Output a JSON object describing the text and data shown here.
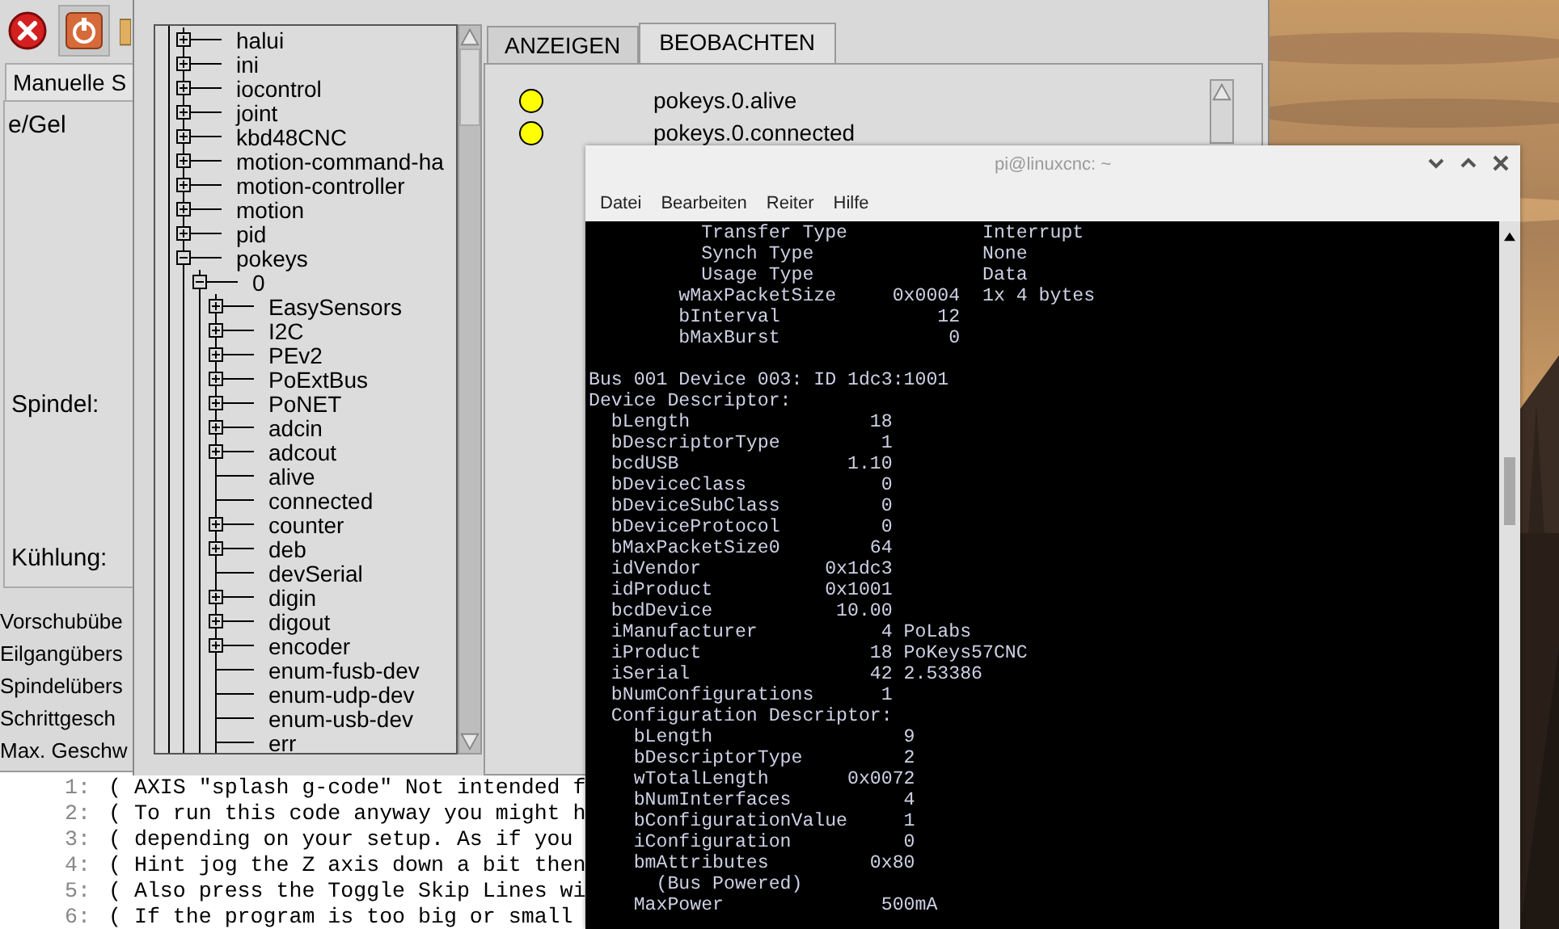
{
  "axis": {
    "tab_label": "Manuelle S",
    "panel_labels": [
      "e/Gel",
      "Spindel:",
      "Kühlung:"
    ],
    "override_labels": [
      "Vorschubübe",
      "Eilgangübers",
      "Spindelübers",
      "Schrittgesch",
      "Max. Geschw"
    ],
    "program": [
      {
        "number": "1:",
        "text": "( AXIS \"splash g-code\" Not intended f"
      },
      {
        "number": "2:",
        "text": "( To run this code anyway you might h"
      },
      {
        "number": "3:",
        "text": "( depending on your setup. As if you"
      },
      {
        "number": "4:",
        "text": "( Hint jog the Z axis down a bit then"
      },
      {
        "number": "5:",
        "text": "( Also press the Toggle Skip Lines wi"
      },
      {
        "number": "6:",
        "text": "( If the program is too big or small"
      }
    ]
  },
  "hal": {
    "tree": [
      {
        "label": "halui",
        "kind": "branch",
        "expanded": false
      },
      {
        "label": "ini",
        "kind": "branch",
        "expanded": false
      },
      {
        "label": "iocontrol",
        "kind": "branch",
        "expanded": false
      },
      {
        "label": "joint",
        "kind": "branch",
        "expanded": false
      },
      {
        "label": "kbd48CNC",
        "kind": "branch",
        "expanded": false
      },
      {
        "label": "motion-command-ha",
        "kind": "branch",
        "expanded": false
      },
      {
        "label": "motion-controller",
        "kind": "branch",
        "expanded": false
      },
      {
        "label": "motion",
        "kind": "branch",
        "expanded": false
      },
      {
        "label": "pid",
        "kind": "branch",
        "expanded": false
      },
      {
        "label": "pokeys",
        "kind": "branch",
        "expanded": true,
        "children": [
          {
            "label": "0",
            "kind": "branch",
            "expanded": true,
            "children": [
              {
                "label": "EasySensors",
                "kind": "branch",
                "expanded": false
              },
              {
                "label": "I2C",
                "kind": "branch",
                "expanded": false
              },
              {
                "label": "PEv2",
                "kind": "branch",
                "expanded": false
              },
              {
                "label": "PoExtBus",
                "kind": "branch",
                "expanded": false
              },
              {
                "label": "PoNET",
                "kind": "branch",
                "expanded": false
              },
              {
                "label": "adcin",
                "kind": "branch",
                "expanded": false
              },
              {
                "label": "adcout",
                "kind": "branch",
                "expanded": false
              },
              {
                "label": "alive",
                "kind": "leaf"
              },
              {
                "label": "connected",
                "kind": "leaf"
              },
              {
                "label": "counter",
                "kind": "branch",
                "expanded": false
              },
              {
                "label": "deb",
                "kind": "branch",
                "expanded": false
              },
              {
                "label": "devSerial",
                "kind": "leaf"
              },
              {
                "label": "digin",
                "kind": "branch",
                "expanded": false
              },
              {
                "label": "digout",
                "kind": "branch",
                "expanded": false
              },
              {
                "label": "encoder",
                "kind": "branch",
                "expanded": false
              },
              {
                "label": "enum-fusb-dev",
                "kind": "leaf"
              },
              {
                "label": "enum-udp-dev",
                "kind": "leaf"
              },
              {
                "label": "enum-usb-dev",
                "kind": "leaf"
              },
              {
                "label": "err",
                "kind": "leaf"
              }
            ]
          }
        ]
      }
    ],
    "tabs": [
      {
        "label": "ANZEIGEN",
        "selected": false
      },
      {
        "label": "BEOBACHTEN",
        "selected": true
      }
    ],
    "watch": [
      {
        "name": "pokeys.0.alive",
        "on": true
      },
      {
        "name": "pokeys.0.connected",
        "on": true
      }
    ]
  },
  "terminal": {
    "title": "pi@linuxcnc: ~",
    "menu": [
      "Datei",
      "Bearbeiten",
      "Reiter",
      "Hilfe"
    ],
    "blocks": [
      [
        "          Transfer Type            Interrupt",
        "          Synch Type               None",
        "          Usage Type               Data",
        "        wMaxPacketSize     0x0004  1x 4 bytes",
        "        bInterval              12",
        "        bMaxBurst               0"
      ],
      [
        "Bus 001 Device 003: ID 1dc3:1001",
        "Device Descriptor:",
        "  bLength                18",
        "  bDescriptorType         1",
        "  bcdUSB               1.10",
        "  bDeviceClass            0",
        "  bDeviceSubClass         0",
        "  bDeviceProtocol         0",
        "  bMaxPacketSize0        64",
        "  idVendor           0x1dc3",
        "  idProduct          0x1001",
        "  bcdDevice           10.00",
        "  iManufacturer           4 PoLabs",
        "  iProduct               18 PoKeys57CNC",
        "  iSerial                42 2.53386",
        "  bNumConfigurations      1",
        "  Configuration Descriptor:",
        "    bLength                 9",
        "    bDescriptorType         2",
        "    wTotalLength       0x0072",
        "    bNumInterfaces          4",
        "    bConfigurationValue     1",
        "    iConfiguration          0",
        "    bmAttributes         0x80",
        "      (Bus Powered)",
        "    MaxPower              500mA"
      ]
    ]
  }
}
